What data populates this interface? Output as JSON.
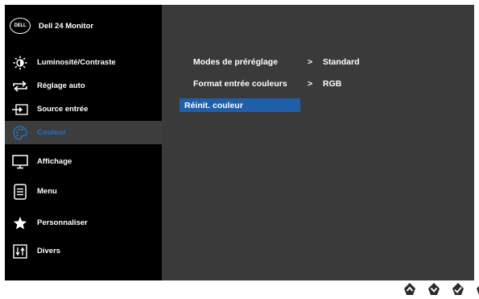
{
  "brand": {
    "logo": "DELL",
    "title": "Dell 24 Monitor"
  },
  "menu": [
    {
      "label": "Luminosité/Contraste",
      "icon": "brightness-icon",
      "active": false
    },
    {
      "label": "Réglage auto",
      "icon": "auto-adjust-icon",
      "active": false
    },
    {
      "label": "Source entrée",
      "icon": "input-source-icon",
      "active": false
    },
    {
      "label": "Couleur",
      "icon": "color-palette-icon",
      "active": true
    },
    {
      "label": "Affichage",
      "icon": "display-icon",
      "active": false
    },
    {
      "label": "Menu",
      "icon": "menu-icon",
      "active": false
    },
    {
      "label": "Personnaliser",
      "icon": "star-icon",
      "active": false
    },
    {
      "label": "Divers",
      "icon": "sliders-icon",
      "active": false
    }
  ],
  "settings": [
    {
      "name": "Modes de préréglage",
      "arrow": ">",
      "value": "Standard"
    },
    {
      "name": "Format entrée couleurs",
      "arrow": ">",
      "value": "RGB"
    },
    {
      "name": "Réinit. couleur",
      "arrow": "",
      "value": ""
    }
  ],
  "footer_buttons": [
    "up-icon",
    "down-icon",
    "confirm-icon",
    "exit-icon"
  ],
  "colors": {
    "panel": "#3a3a3a",
    "sidebar": "#000000",
    "highlight": "#1f5faa",
    "active_text": "#1e73be"
  }
}
